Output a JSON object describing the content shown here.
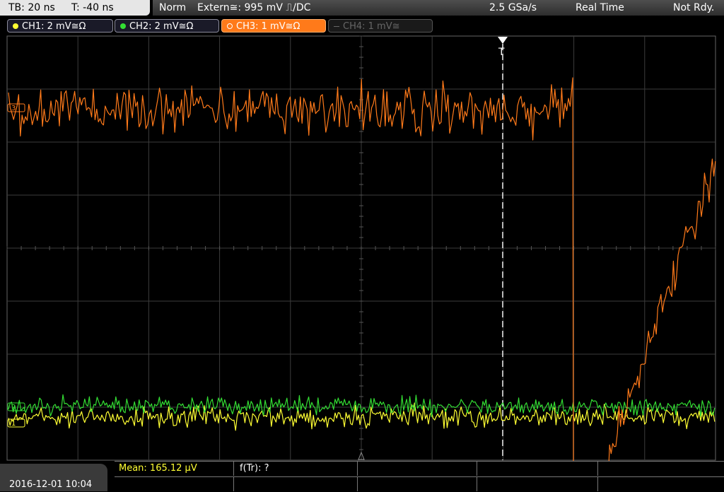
{
  "topbar": {
    "timebase": "TB: 20 ns",
    "trigger_offset": "T: -40 ns",
    "mode": "Norm",
    "trigger_source": "Extern≅: 995 mV ⎍/DC",
    "sample_rate": "2.5 GSa/s",
    "acq_mode": "Real Time",
    "status": "Not Rdy."
  },
  "channels": [
    {
      "label": "CH1: 2 mV≅Ω",
      "color": "#ffff33",
      "state": "on"
    },
    {
      "label": "CH2: 2 mV≅Ω",
      "color": "#33dd33",
      "state": "on"
    },
    {
      "label": "CH3: 1 mV≅Ω",
      "color": "#ff7a1a",
      "state": "active"
    },
    {
      "label": "CH4: 1 mV≅",
      "color": "#666666",
      "state": "off"
    }
  ],
  "screen": {
    "trigger_marker": "T",
    "ch3_marker": "3",
    "ch1_marker": "1",
    "ch2_marker": "2"
  },
  "bottom": {
    "datetime": "2016-12-01 10:04",
    "mean_label": "Mean: 165.12 µV",
    "freq_label": "f(Tr): ?"
  },
  "colors": {
    "ch1": "#ffff33",
    "ch2": "#33dd33",
    "ch3": "#ff7a1a",
    "grid": "#3c3c3c"
  }
}
